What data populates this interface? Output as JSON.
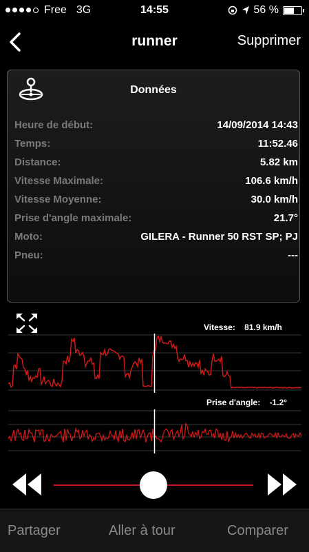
{
  "status": {
    "carrier": "Free",
    "network": "3G",
    "time": "14:55",
    "battery": "56 %",
    "battery_level": 0.56
  },
  "nav": {
    "back_icon": "chevron-left-icon",
    "title": "runner",
    "action_label": "Supprimer"
  },
  "panel": {
    "icon": "map-pin-icon",
    "title": "Données",
    "rows": [
      {
        "label": "Heure de début:",
        "value": "14/09/2014 14:43"
      },
      {
        "label": "Temps:",
        "value": "11:52.46"
      },
      {
        "label": "Distance:",
        "value": "5.82 km"
      },
      {
        "label": "Vitesse Maximale:",
        "value": "106.6 km/h"
      },
      {
        "label": "Vitesse Moyenne:",
        "value": "30.0 km/h"
      },
      {
        "label": "Prise d'angle maximale:",
        "value": "21.7°"
      },
      {
        "label": "Moto:",
        "value": "GILERA - Runner 50 RST SP; PJ"
      },
      {
        "label": "Pneu:",
        "value": "---"
      }
    ]
  },
  "graphs": {
    "speed": {
      "label": "Vitesse:",
      "value": "81.9 km/h"
    },
    "lean": {
      "label": "Prise d'angle:",
      "value": "-1.2°"
    },
    "cursor_fraction": 0.5,
    "line_color": "#d01818"
  },
  "playback": {
    "position": 0.5,
    "accent": "#c8171e"
  },
  "toolbar": {
    "share": "Partager",
    "goto": "Aller à tour",
    "compare": "Comparer"
  }
}
